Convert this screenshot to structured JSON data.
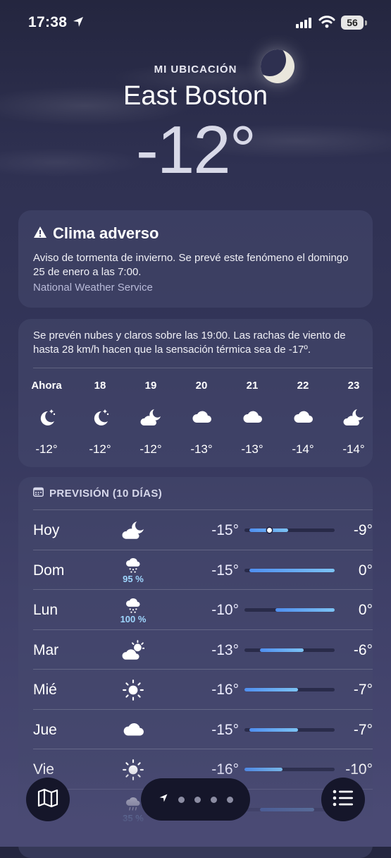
{
  "status_bar": {
    "time": "17:38",
    "battery": "56"
  },
  "header": {
    "location_label": "MI UBICACIÓN",
    "city": "East Boston",
    "current_temp": "-12°"
  },
  "alert": {
    "title": "Clima adverso",
    "description": "Aviso de tormenta de invierno. Se prevé este fenómeno el domingo 25 de enero a las 7:00.",
    "source": "National Weather Service"
  },
  "hourly": {
    "summary": "Se prevén nubes y claros sobre las 19:00. Las rachas de viento de hasta 28 km/h hacen que la sensación térmica sea de -17º.",
    "items": [
      {
        "label": "Ahora",
        "icon": "moon-stars-icon",
        "temp": "-12°"
      },
      {
        "label": "18",
        "icon": "moon-stars-icon",
        "temp": "-12°"
      },
      {
        "label": "19",
        "icon": "cloud-moon-icon",
        "temp": "-12°"
      },
      {
        "label": "20",
        "icon": "cloud-icon",
        "temp": "-13°"
      },
      {
        "label": "21",
        "icon": "cloud-icon",
        "temp": "-13°"
      },
      {
        "label": "22",
        "icon": "cloud-icon",
        "temp": "-14°"
      },
      {
        "label": "23",
        "icon": "cloud-moon-icon",
        "temp": "-14°"
      }
    ]
  },
  "daily": {
    "heading": "PREVISIÓN (10 DÍAS)",
    "range_min": -16,
    "range_max": 0,
    "days": [
      {
        "day": "Hoy",
        "icon": "cloud-moon-icon",
        "precip": "",
        "low": "-15°",
        "high": "-9°",
        "low_val": -15,
        "high_val": -9,
        "current_val": -12
      },
      {
        "day": "Dom",
        "icon": "cloud-snow-icon",
        "precip": "95 %",
        "low": "-15°",
        "high": "0°",
        "low_val": -15,
        "high_val": 0
      },
      {
        "day": "Lun",
        "icon": "cloud-snow-icon",
        "precip": "100 %",
        "low": "-10°",
        "high": "0°",
        "low_val": -10,
        "high_val": 0
      },
      {
        "day": "Mar",
        "icon": "cloud-sun-icon",
        "precip": "",
        "low": "-13°",
        "high": "-6°",
        "low_val": -13,
        "high_val": -6
      },
      {
        "day": "Mié",
        "icon": "sun-icon",
        "precip": "",
        "low": "-16°",
        "high": "-7°",
        "low_val": -16,
        "high_val": -7
      },
      {
        "day": "Jue",
        "icon": "cloud-icon",
        "precip": "",
        "low": "-15°",
        "high": "-7°",
        "low_val": -15,
        "high_val": -7
      },
      {
        "day": "Vie",
        "icon": "sun-icon",
        "precip": "",
        "low": "-16°",
        "high": "-10°",
        "low_val": -16,
        "high_val": -10
      },
      {
        "day": "",
        "icon": "cloud-rain-icon",
        "precip": "35 %",
        "low": "",
        "high": "",
        "low_val": -13,
        "high_val": -4
      }
    ]
  },
  "colors": {
    "background": "#34365a",
    "card": "#46486e",
    "accent": "#4f8ff0",
    "precip": "#9fd7ff"
  }
}
